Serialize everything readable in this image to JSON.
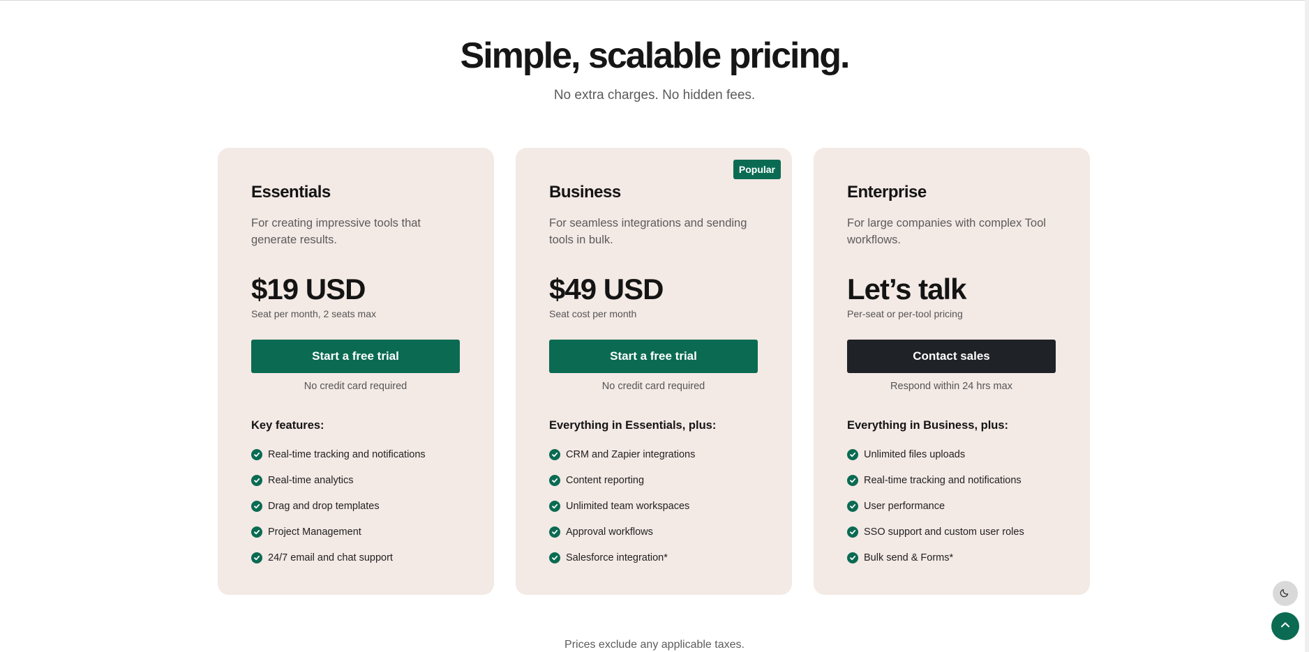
{
  "hero": {
    "title": "Simple, scalable pricing.",
    "subtitle": "No extra charges. No hidden fees."
  },
  "plans": [
    {
      "name": "Essentials",
      "description": "For creating impressive tools that generate results.",
      "price": "$19 USD",
      "price_note": "Seat per month, 2 seats max",
      "cta_label": "Start a free trial",
      "cta_note": "No credit card required",
      "features_title": "Key features:",
      "features": [
        "Real-time tracking and notifications",
        "Real-time analytics",
        "Drag and drop templates",
        "Project Management",
        "24/7 email and chat support"
      ]
    },
    {
      "name": "Business",
      "badge": "Popular",
      "description": "For seamless integrations and sending tools in bulk.",
      "price": "$49 USD",
      "price_note": "Seat cost per month",
      "cta_label": "Start a free trial",
      "cta_note": "No credit card required",
      "features_title": "Everything in Essentials, plus:",
      "features": [
        "CRM and Zapier integrations",
        "Content reporting",
        "Unlimited team workspaces",
        "Approval workflows",
        "Salesforce integration*"
      ]
    },
    {
      "name": "Enterprise",
      "description": "For large companies with complex Tool workflows.",
      "price": "Let’s talk",
      "price_note": "Per-seat or per-tool pricing",
      "cta_label": "Contact sales",
      "cta_note": "Respond within 24 hrs max",
      "features_title": "Everything in Business, plus:",
      "features": [
        "Unlimited files uploads",
        "Real-time tracking and notifications",
        "User performance",
        "SSO support and custom user roles",
        "Bulk send & Forms*"
      ]
    }
  ],
  "footnote": "Prices exclude any applicable taxes.",
  "icons": {
    "feature": "check-circle-icon",
    "theme_toggle": "moon-icon",
    "scroll_top": "chevron-up-icon"
  },
  "colors": {
    "accent": "#0a6b52",
    "card_bg": "#f3e9e5",
    "dark_button": "#1f2226"
  }
}
